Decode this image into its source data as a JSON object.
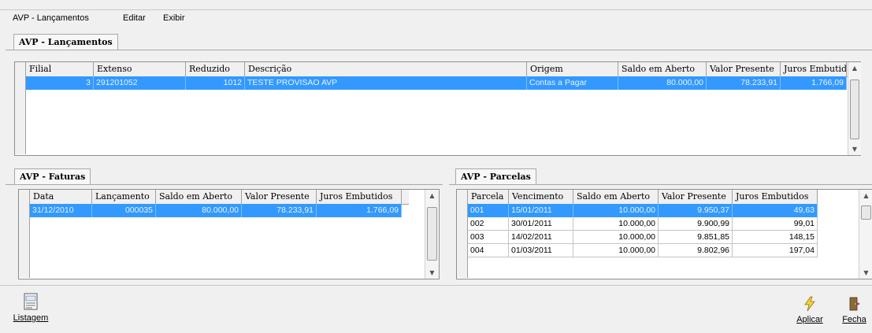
{
  "menu": {
    "items": [
      "AVP - Lançamentos",
      "Editar",
      "Exibir"
    ]
  },
  "lancamentos": {
    "tab_label": "AVP - Lançamentos",
    "columns": [
      "Filial",
      "Extenso",
      "Reduzido",
      "Descrição",
      "Origem",
      "Saldo em Aberto",
      "Valor Presente",
      "Juros Embutidos"
    ],
    "rows": [
      [
        "3",
        "291201052",
        "1012",
        "TESTE PROVISAO AVP",
        "Contas a Pagar",
        "80.000,00",
        "78.233,91",
        "1.766,09"
      ]
    ]
  },
  "faturas": {
    "tab_label": "AVP - Faturas",
    "columns": [
      "Data",
      "Lançamento",
      "Saldo em Aberto",
      "Valor Presente",
      "Juros Embutidos"
    ],
    "rows": [
      [
        "31/12/2010",
        "000035",
        "80.000,00",
        "78.233,91",
        "1.766,09"
      ]
    ]
  },
  "parcelas": {
    "tab_label": "AVP - Parcelas",
    "columns": [
      "Parcela",
      "Vencimento",
      "Saldo em Aberto",
      "Valor Presente",
      "Juros Embutidos"
    ],
    "rows": [
      [
        "001",
        "15/01/2011",
        "10.000,00",
        "9.950,37",
        "49,63"
      ],
      [
        "002",
        "30/01/2011",
        "10.000,00",
        "9.900,99",
        "99,01"
      ],
      [
        "003",
        "14/02/2011",
        "10.000,00",
        "9.851,85",
        "148,15"
      ],
      [
        "004",
        "01/03/2011",
        "10.000,00",
        "9.802,96",
        "197,04"
      ]
    ]
  },
  "toolbar": {
    "listagem_label": "Listagem",
    "aplicar_label": "Aplicar",
    "fechar_label": "Fecha"
  },
  "colors": {
    "selection": "#3399ff",
    "window_bg": "#f0f0f0",
    "grid_bg": "#ffffff"
  },
  "icons": {
    "listagem": "report-icon",
    "aplicar": "lightning-icon",
    "fechar": "door-exit-icon"
  }
}
